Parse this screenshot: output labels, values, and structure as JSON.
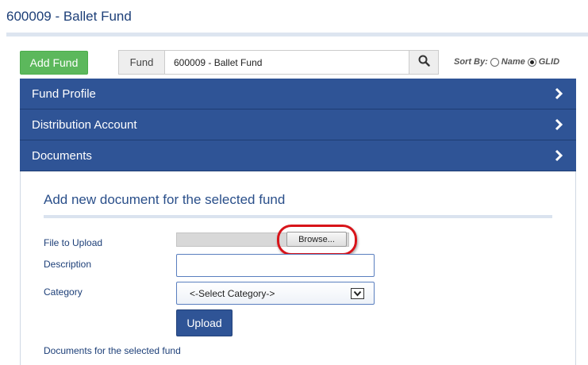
{
  "page": {
    "title": "600009 - Ballet Fund"
  },
  "toolbar": {
    "add_fund_label": "Add Fund",
    "fund_label": "Fund",
    "fund_value": "600009 - Ballet Fund",
    "search_icon": "search-icon",
    "sort_by_label": "Sort By:",
    "sort_options": [
      {
        "label": "Name",
        "selected": false
      },
      {
        "label": "GLID",
        "selected": true
      }
    ]
  },
  "accordion": [
    {
      "label": "Fund Profile",
      "icon": "chevron-right-icon"
    },
    {
      "label": "Distribution Account",
      "icon": "chevron-right-icon"
    },
    {
      "label": "Documents",
      "icon": "chevron-right-icon"
    }
  ],
  "documents": {
    "heading": "Add new document for the selected fund",
    "file_label": "File to Upload",
    "browse_label": "Browse...",
    "description_label": "Description",
    "description_value": "",
    "category_label": "Category",
    "category_selected": "<-Select Category->",
    "upload_label": "Upload",
    "list_heading": "Documents for the selected fund"
  },
  "colors": {
    "header_blue": "#2f5496",
    "add_green": "#5cb85c",
    "highlight_red": "#d8141a",
    "title_text": "#1d3f78"
  }
}
